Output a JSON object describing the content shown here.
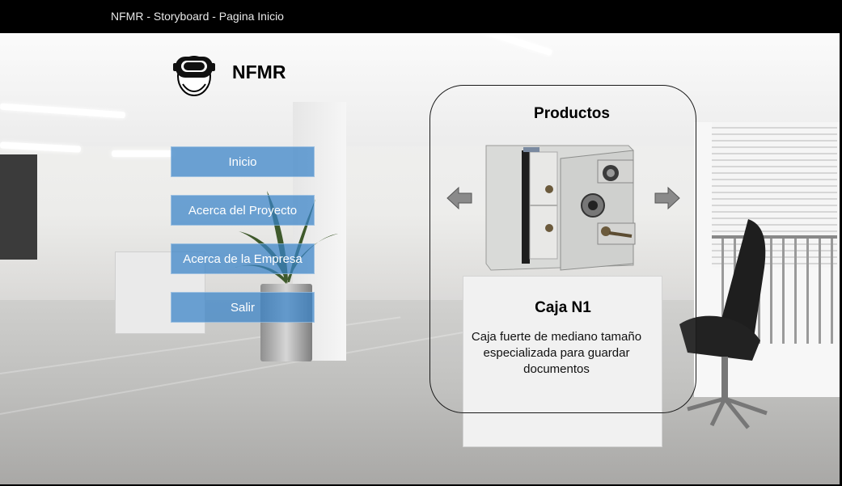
{
  "window": {
    "title": "NFMR - Storyboard - Pagina Inicio"
  },
  "brand": {
    "name": "NFMR",
    "icon": "vr-headset-icon"
  },
  "menu": {
    "items": [
      {
        "label": "Inicio"
      },
      {
        "label": "Acerca del Proyecto"
      },
      {
        "label": "Acerca de la Empresa"
      },
      {
        "label": "Salir"
      }
    ]
  },
  "products": {
    "heading": "Productos",
    "current": {
      "name": "Caja N1",
      "description": "Caja fuerte de mediano tamaño especializada para guardar documentos",
      "image": "safe-box-image"
    },
    "prev_icon": "arrow-left-icon",
    "next_icon": "arrow-right-icon"
  },
  "colors": {
    "menu_button": "#3882c8",
    "title_bar": "#000000",
    "title_text": "#e8e8e8"
  }
}
